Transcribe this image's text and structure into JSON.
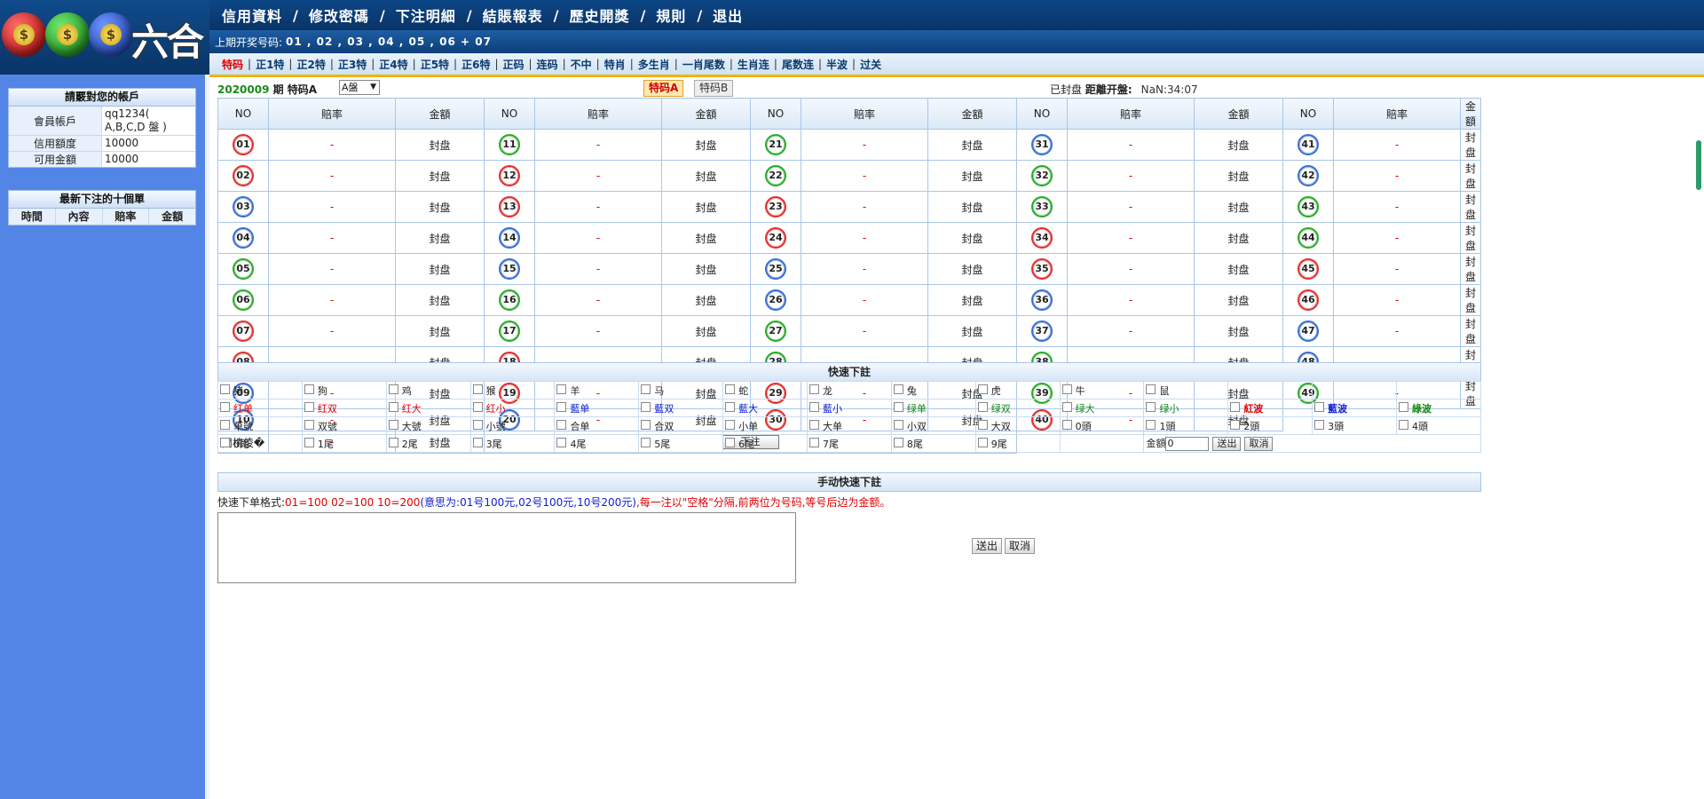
{
  "logo": {
    "text": "六合",
    "coin_symbol": "$"
  },
  "topnav": [
    "信用資料",
    "修改密碼",
    "下注明細",
    "結賬報表",
    "歷史開獎",
    "規則",
    "退出"
  ],
  "last_draw": {
    "label": "上期开奖号码:",
    "numbers": "01 , 02 , 03 , 04 , 05 , 06 + 07"
  },
  "subnav": [
    "特码",
    "正1特",
    "正2特",
    "正3特",
    "正4特",
    "正5特",
    "正6特",
    "正码",
    "连码",
    "不中",
    "特肖",
    "多生肖",
    "一肖尾数",
    "生肖连",
    "尾数连",
    "半波",
    "过关"
  ],
  "sidebar": {
    "account": {
      "title": "請覈對您的帳戶",
      "rows": [
        {
          "label": "會員帳戶",
          "value": "qq1234( A,B,C,D 盤 )"
        },
        {
          "label": "信用額度",
          "value": "10000"
        },
        {
          "label": "可用金額",
          "value": "10000"
        }
      ]
    },
    "recent": {
      "title": "最新下注的十個單",
      "headers": [
        "時間",
        "內容",
        "賠率",
        "金額"
      ]
    }
  },
  "infobar": {
    "period_number": "2020009",
    "period_suffix": " 期 特码A",
    "pan_select": "A盤",
    "tab_a": "特码A",
    "tab_b": "特码B",
    "status": "已封盘",
    "countdown_label": "距離开盤:",
    "countdown": "NaN:34:07"
  },
  "grid": {
    "headers": [
      "NO",
      "賠率",
      "金額"
    ],
    "odds": "-",
    "amount": "封盘",
    "numbers": [
      {
        "n": "01",
        "c": "red"
      },
      {
        "n": "02",
        "c": "red"
      },
      {
        "n": "03",
        "c": "blue"
      },
      {
        "n": "04",
        "c": "blue"
      },
      {
        "n": "05",
        "c": "green"
      },
      {
        "n": "06",
        "c": "green"
      },
      {
        "n": "07",
        "c": "red"
      },
      {
        "n": "08",
        "c": "red"
      },
      {
        "n": "09",
        "c": "blue"
      },
      {
        "n": "10",
        "c": "blue"
      },
      {
        "n": "11",
        "c": "green"
      },
      {
        "n": "12",
        "c": "red"
      },
      {
        "n": "13",
        "c": "red"
      },
      {
        "n": "14",
        "c": "blue"
      },
      {
        "n": "15",
        "c": "blue"
      },
      {
        "n": "16",
        "c": "green"
      },
      {
        "n": "17",
        "c": "green"
      },
      {
        "n": "18",
        "c": "red"
      },
      {
        "n": "19",
        "c": "red"
      },
      {
        "n": "20",
        "c": "blue"
      },
      {
        "n": "21",
        "c": "green"
      },
      {
        "n": "22",
        "c": "green"
      },
      {
        "n": "23",
        "c": "red"
      },
      {
        "n": "24",
        "c": "red"
      },
      {
        "n": "25",
        "c": "blue"
      },
      {
        "n": "26",
        "c": "blue"
      },
      {
        "n": "27",
        "c": "green"
      },
      {
        "n": "28",
        "c": "green"
      },
      {
        "n": "29",
        "c": "red"
      },
      {
        "n": "30",
        "c": "red"
      },
      {
        "n": "31",
        "c": "blue"
      },
      {
        "n": "32",
        "c": "green"
      },
      {
        "n": "33",
        "c": "green"
      },
      {
        "n": "34",
        "c": "red"
      },
      {
        "n": "35",
        "c": "red"
      },
      {
        "n": "36",
        "c": "blue"
      },
      {
        "n": "37",
        "c": "blue"
      },
      {
        "n": "38",
        "c": "green"
      },
      {
        "n": "39",
        "c": "green"
      },
      {
        "n": "40",
        "c": "red"
      },
      {
        "n": "41",
        "c": "blue"
      },
      {
        "n": "42",
        "c": "blue"
      },
      {
        "n": "43",
        "c": "green"
      },
      {
        "n": "44",
        "c": "green"
      },
      {
        "n": "45",
        "c": "red"
      },
      {
        "n": "46",
        "c": "red"
      },
      {
        "n": "47",
        "c": "blue"
      },
      {
        "n": "48",
        "c": "blue"
      },
      {
        "n": "49",
        "c": "green"
      }
    ],
    "extra_label": "閫樻倰�",
    "submit_label": "下注"
  },
  "quick_bet": {
    "title": "快速下註",
    "rows": [
      [
        {
          "t": "猪"
        },
        {
          "t": "狗"
        },
        {
          "t": "鸡"
        },
        {
          "t": "猴"
        },
        {
          "t": "羊"
        },
        {
          "t": "马"
        },
        {
          "t": "蛇"
        },
        {
          "t": "龙"
        },
        {
          "t": "兔"
        },
        {
          "t": "虎"
        },
        {
          "t": "牛"
        },
        {
          "t": "鼠"
        },
        {
          "t": ""
        },
        {
          "t": ""
        },
        {
          "t": ""
        }
      ],
      [
        {
          "t": "红单",
          "c": "red"
        },
        {
          "t": "红双",
          "c": "red"
        },
        {
          "t": "红大",
          "c": "red"
        },
        {
          "t": "红小",
          "c": "red"
        },
        {
          "t": "藍单",
          "c": "blue"
        },
        {
          "t": "藍双",
          "c": "blue"
        },
        {
          "t": "藍大",
          "c": "blue"
        },
        {
          "t": "藍小",
          "c": "blue"
        },
        {
          "t": "绿单",
          "c": "green"
        },
        {
          "t": "绿双",
          "c": "green"
        },
        {
          "t": "绿大",
          "c": "green"
        },
        {
          "t": "绿小",
          "c": "green"
        },
        {
          "t": "紅波",
          "c": "red"
        },
        {
          "t": "藍波",
          "c": "blue"
        },
        {
          "t": "綠波",
          "c": "green"
        }
      ],
      [
        {
          "t": "单號"
        },
        {
          "t": "双號"
        },
        {
          "t": "大號"
        },
        {
          "t": "小號"
        },
        {
          "t": "合单"
        },
        {
          "t": "合双"
        },
        {
          "t": "小单"
        },
        {
          "t": "大单"
        },
        {
          "t": "小双"
        },
        {
          "t": "大双"
        },
        {
          "t": "0頭"
        },
        {
          "t": "1頭"
        },
        {
          "t": "2頭"
        },
        {
          "t": "3頭"
        },
        {
          "t": "4頭"
        }
      ],
      [
        {
          "t": "0尾"
        },
        {
          "t": "1尾"
        },
        {
          "t": "2尾"
        },
        {
          "t": "3尾"
        },
        {
          "t": "4尾"
        },
        {
          "t": "5尾"
        },
        {
          "t": "6尾"
        },
        {
          "t": "7尾"
        },
        {
          "t": "8尾"
        },
        {
          "t": "9尾"
        }
      ]
    ],
    "amount_label": "金額",
    "amount_value": "0",
    "send": "送出",
    "cancel": "取消"
  },
  "manual": {
    "title": "手动快速下註",
    "format_label": "快速下单格式:",
    "format_example": "01=100 02=100 10=200",
    "format_meaning": "(意思为:01号100元,02号100元,10号200元)",
    "format_rule": ",每一注以\"空格\"分隔,前两位为号码,等号后边为金额。",
    "send": "送出",
    "cancel": "取消"
  },
  "colors": {
    "red": "#e00000",
    "blue": "#1020d0",
    "green": "#138613",
    "header_bg": "#0a3b73",
    "sidebar_bg": "#5385e7",
    "accent": "#f0b400"
  }
}
